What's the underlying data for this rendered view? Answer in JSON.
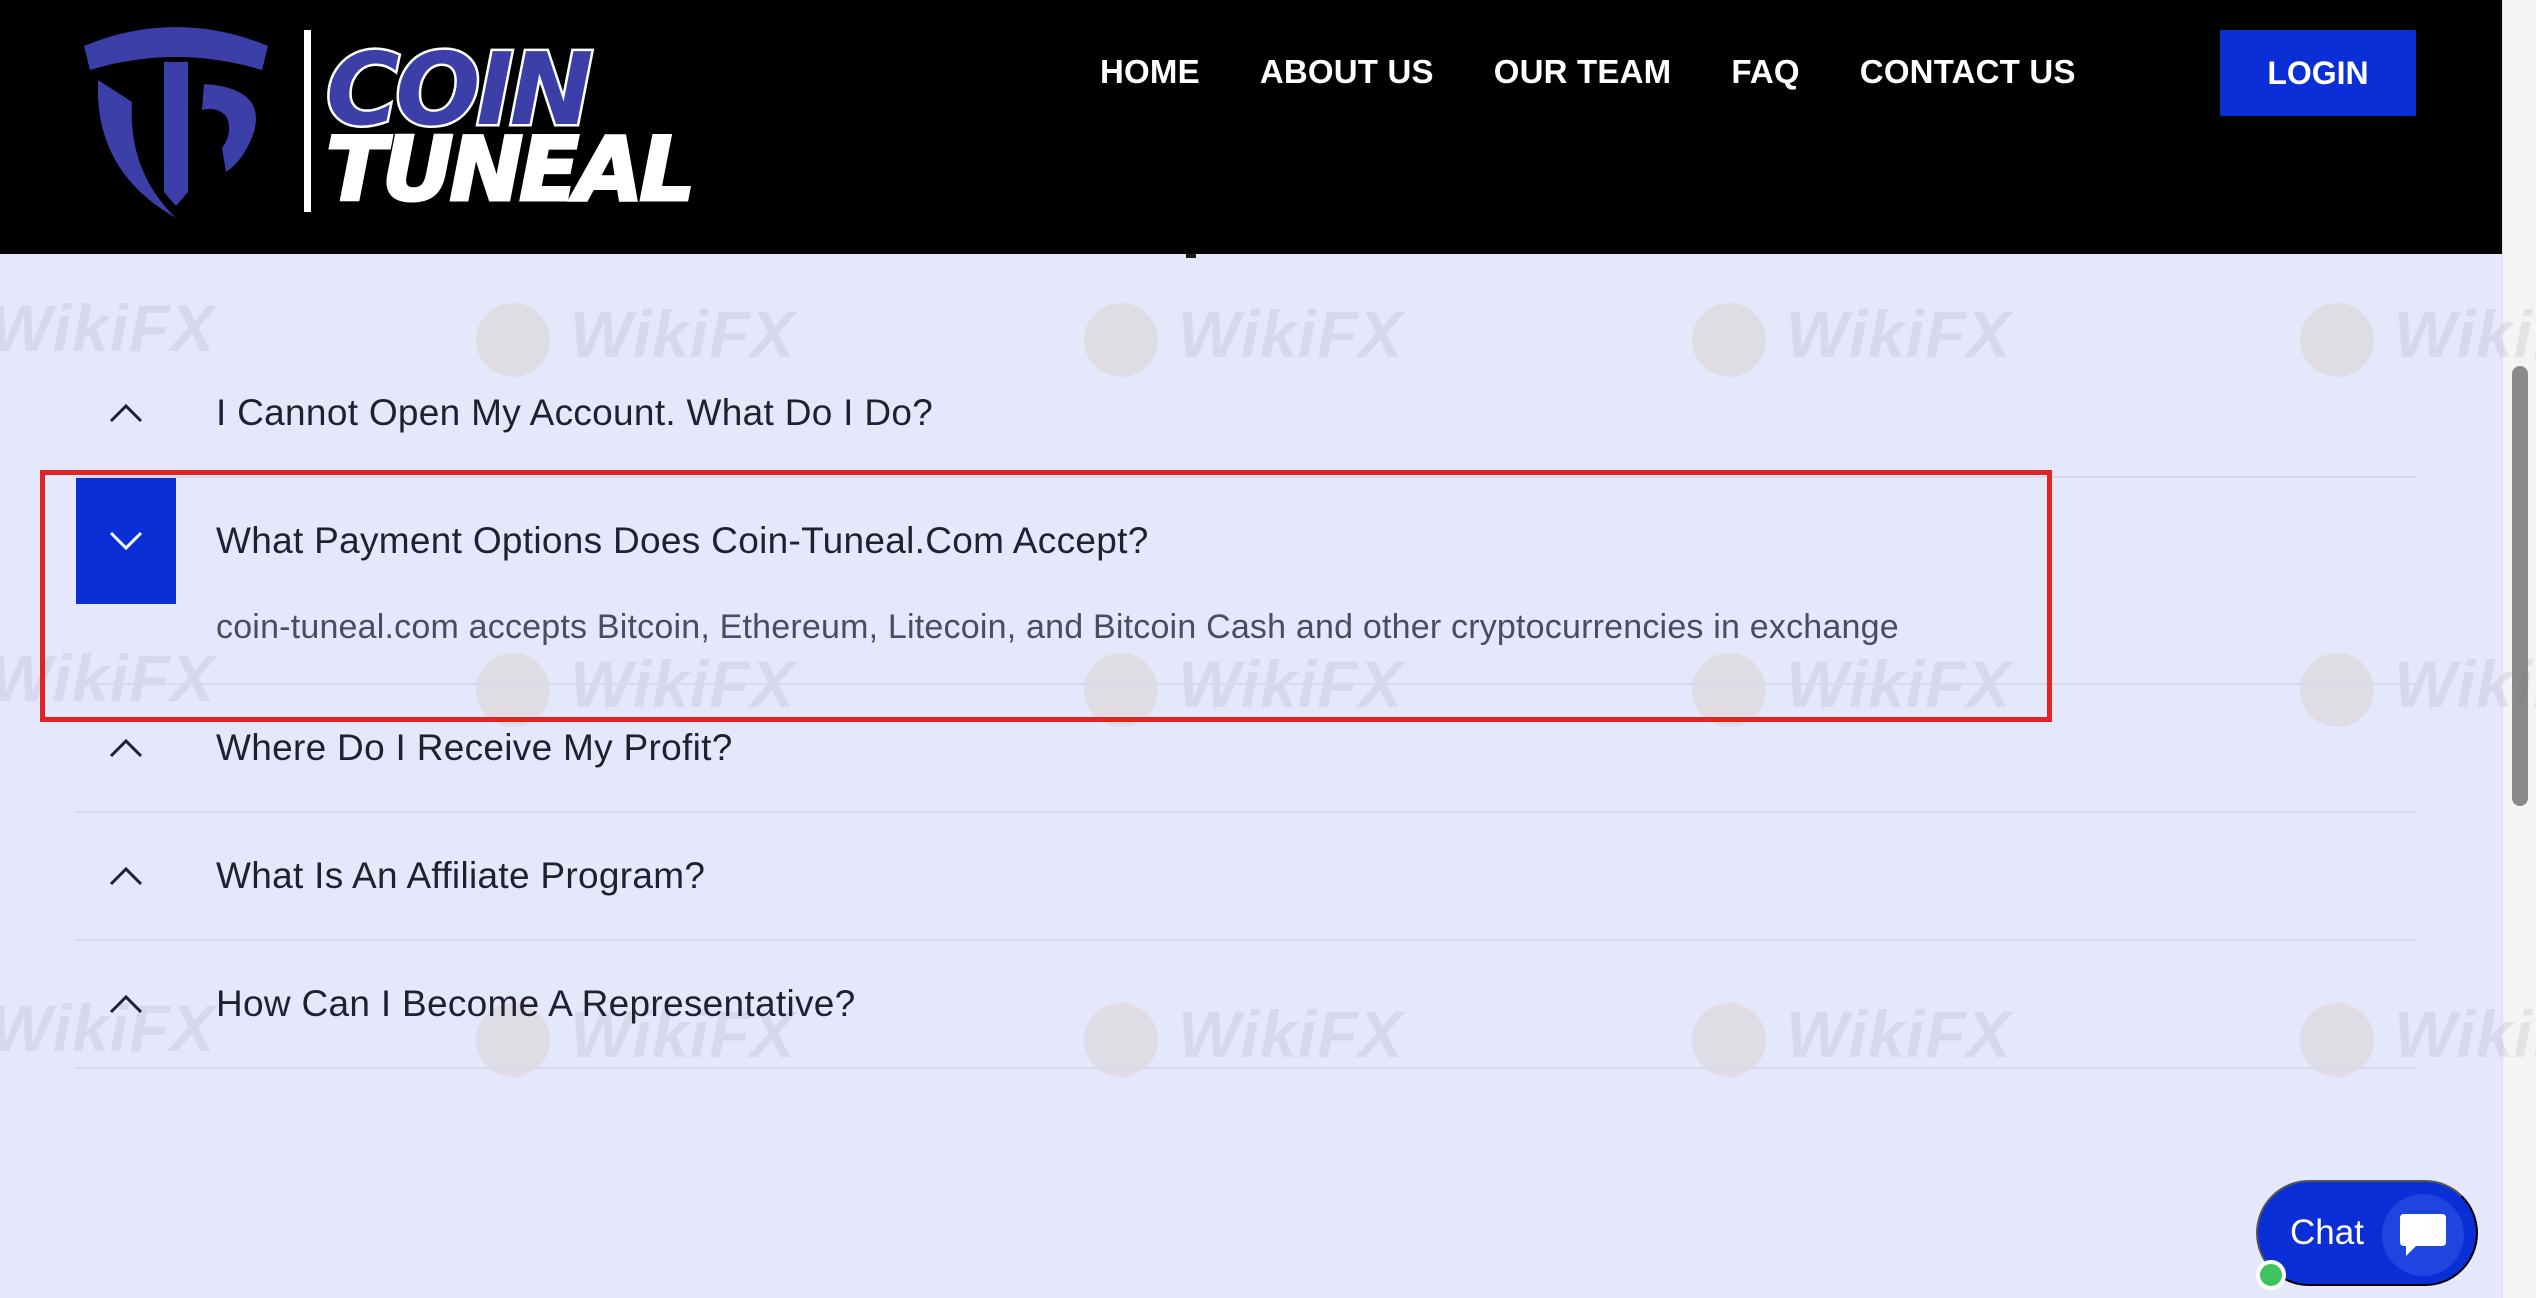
{
  "brand": {
    "word1": "COIN",
    "word2": "TUNEAL",
    "colors": {
      "primary": "#0a2fd6",
      "logo": "#3c3fa8",
      "header": "#000000",
      "page": "#e5e8fb",
      "highlight": "#e02424"
    }
  },
  "nav": {
    "items": [
      "HOME",
      "ABOUT US",
      "OUR TEAM",
      "FAQ",
      "CONTACT US"
    ],
    "login_label": "LOGIN"
  },
  "faq": {
    "items": [
      {
        "question": "I Cannot Open My Account. What Do I Do?",
        "expanded": false,
        "icon": "chevron-up-icon"
      },
      {
        "question": "What Payment Options Does Coin-Tuneal.Com Accept?",
        "expanded": true,
        "icon": "chevron-down-icon",
        "answer": "coin-tuneal.com accepts Bitcoin, Ethereum, Litecoin, and Bitcoin Cash and other cryptocurrencies in exchange"
      },
      {
        "question": "Where Do I Receive My Profit?",
        "expanded": false,
        "icon": "chevron-up-icon"
      },
      {
        "question": "What Is An Affiliate Program?",
        "expanded": false,
        "icon": "chevron-up-icon"
      },
      {
        "question": "How Can I Become A Representative?",
        "expanded": false,
        "icon": "chevron-up-icon"
      }
    ]
  },
  "chat": {
    "label": "Chat",
    "icon": "chat-bubble-icon",
    "status": "online"
  },
  "watermark": {
    "text": "WikiFX"
  }
}
